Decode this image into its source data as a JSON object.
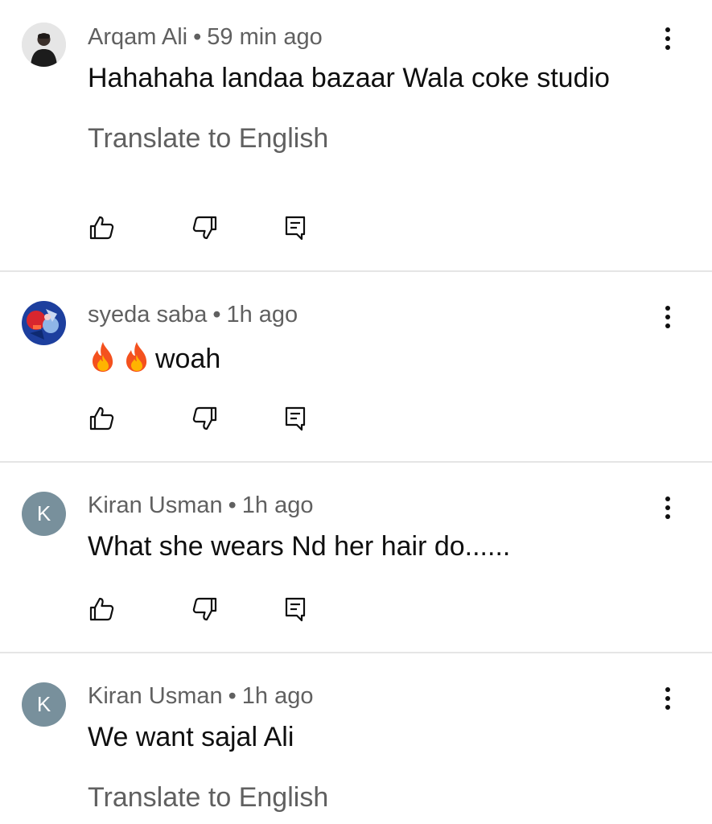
{
  "comments": [
    {
      "author": "Arqam Ali",
      "time": "59 min ago",
      "text": "Hahahaha landaa bazaar Wala coke studio",
      "translate": "Translate to English",
      "avatar": "photo-person-icon"
    },
    {
      "author": "syeda saba",
      "time": "1h ago",
      "text": "woah",
      "emoji": [
        "fire-emoji",
        "fire-emoji"
      ],
      "avatar": "photo-artwork-icon"
    },
    {
      "author": "Kiran Usman",
      "time": "1h ago",
      "text": "What she wears Nd her hair do......",
      "avatar_letter": "K",
      "avatar_color": "#78909c"
    },
    {
      "author": "Kiran Usman",
      "time": "1h ago",
      "text": "We want sajal Ali",
      "translate": "Translate to English",
      "avatar_letter": "K",
      "avatar_color": "#78909c"
    }
  ],
  "separator": "•",
  "icons": {
    "like": "thumbs-up-icon",
    "dislike": "thumbs-down-icon",
    "reply": "reply-comment-icon",
    "more": "more-vertical-icon"
  },
  "colors": {
    "text_primary": "#0f0f0f",
    "text_secondary": "#606060",
    "divider": "#e5e5e5"
  }
}
